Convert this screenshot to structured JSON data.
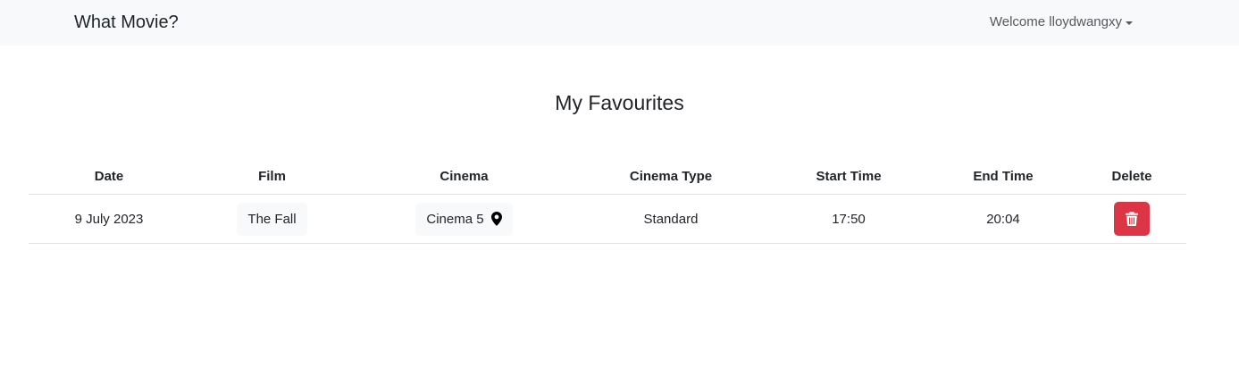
{
  "navbar": {
    "brand": "What Movie?",
    "user_menu": "Welcome lloydwangxy"
  },
  "page": {
    "title": "My Favourites"
  },
  "table": {
    "headers": [
      "Date",
      "Film",
      "Cinema",
      "Cinema Type",
      "Start Time",
      "End Time",
      "Delete"
    ],
    "rows": [
      {
        "date": "9 July 2023",
        "film": "The Fall",
        "cinema": "Cinema 5",
        "cinema_type": "Standard",
        "start_time": "17:50",
        "end_time": "20:04"
      }
    ]
  },
  "icons": {
    "cinema_location": "map-pin-icon",
    "delete": "trash-icon",
    "user_menu": "caret-down-icon"
  },
  "colors": {
    "navbar_bg": "#f8f9fa",
    "delete_button": "#dc3545"
  }
}
